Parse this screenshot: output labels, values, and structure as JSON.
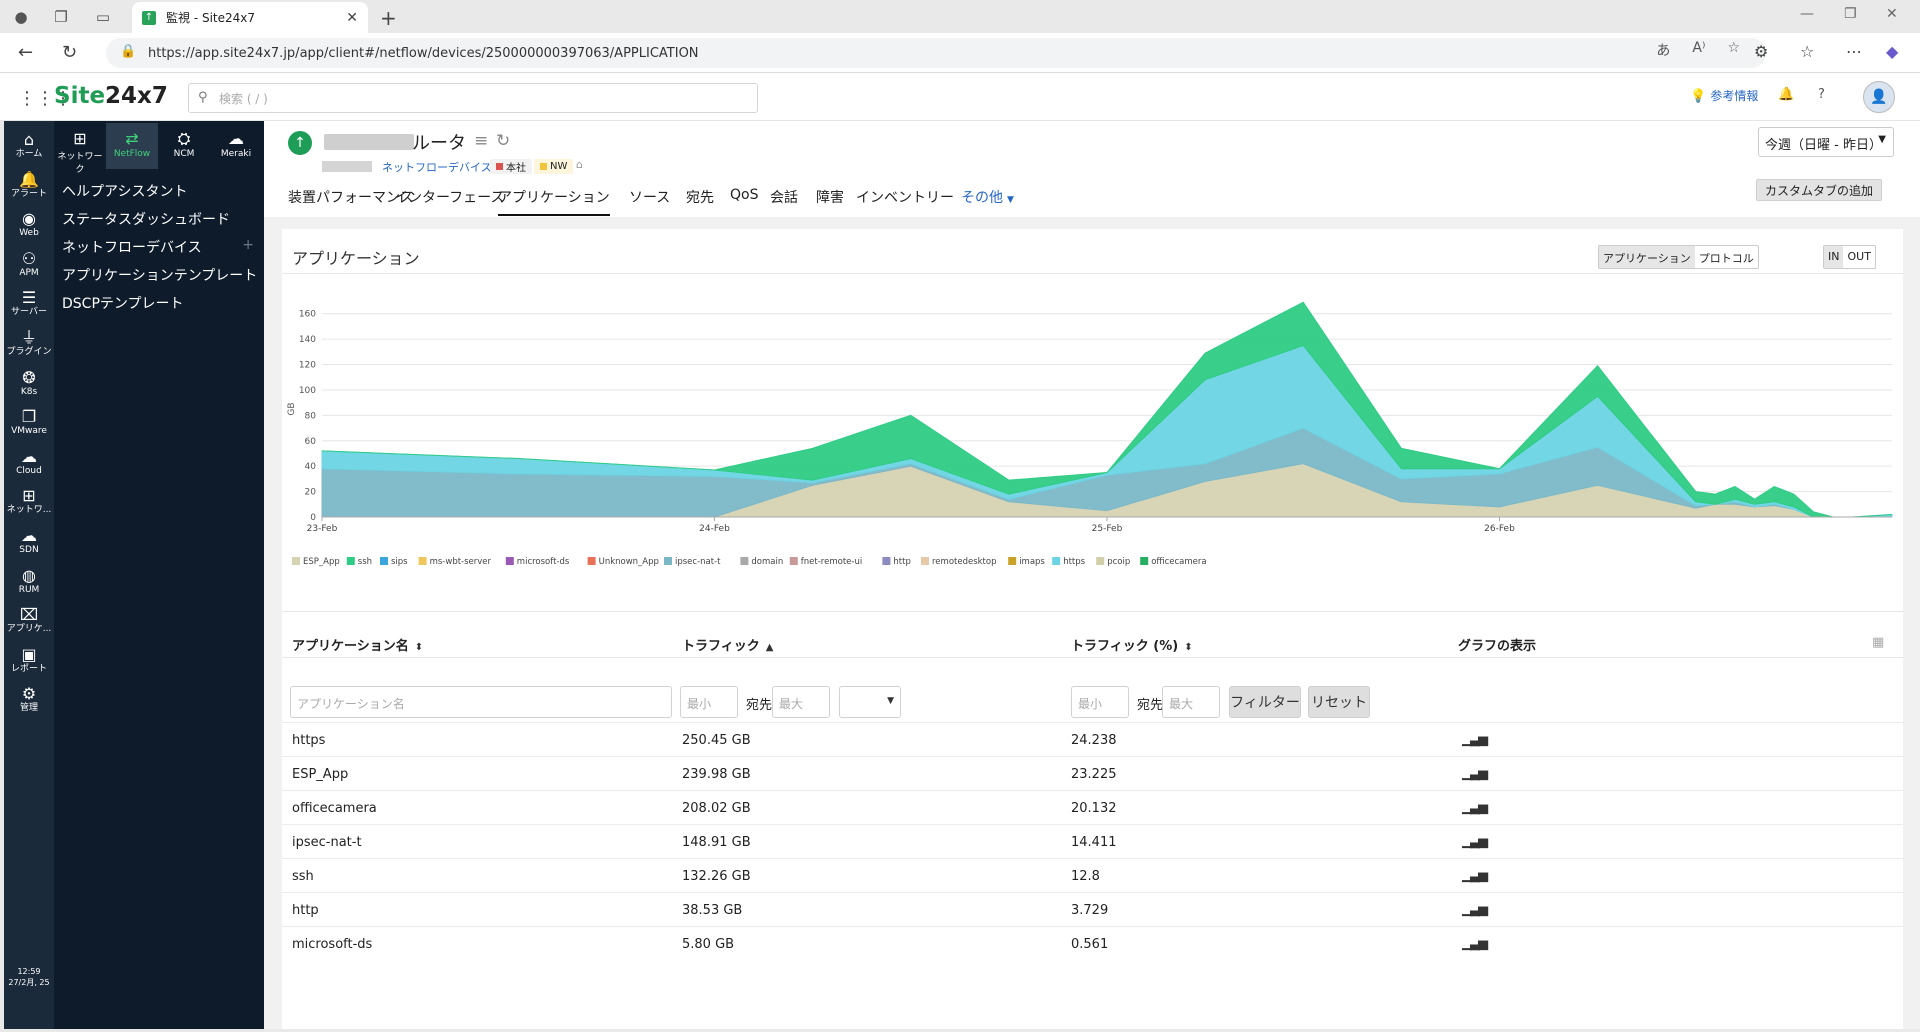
{
  "browser": {
    "tab_title": "監視 - Site24x7",
    "url": "https://app.site24x7.jp/app/client#/netflow/devices/250000000397063/APPLICATION",
    "translate_icon": "translate-icon",
    "read_aloud": "A⁾"
  },
  "app": {
    "logo_a": "Site",
    "logo_b": "24x7",
    "search_placeholder": "検索 ( / )",
    "reference_link": "参考情報",
    "avatar": "👤"
  },
  "rail": {
    "items": [
      {
        "label": "ホーム",
        "icon": "home-icon",
        "glyph": "⌂"
      },
      {
        "label": "アラート",
        "icon": "bell-icon",
        "glyph": "🔔"
      },
      {
        "label": "Web",
        "icon": "globe-icon",
        "glyph": "◉"
      },
      {
        "label": "APM",
        "icon": "binoculars-icon",
        "glyph": "⚇"
      },
      {
        "label": "サーバー",
        "icon": "server-icon",
        "glyph": "☰"
      },
      {
        "label": "プラグイン",
        "icon": "plug-icon",
        "glyph": "⏚"
      },
      {
        "label": "K8s",
        "icon": "k8s-icon",
        "glyph": "❂"
      },
      {
        "label": "VMware",
        "icon": "vmware-icon",
        "glyph": "❐"
      },
      {
        "label": "Cloud",
        "icon": "cloud-icon",
        "glyph": "☁"
      },
      {
        "label": "ネットワ...",
        "icon": "network-icon",
        "glyph": "⊞"
      },
      {
        "label": "SDN",
        "icon": "sdn-icon",
        "glyph": "☁"
      },
      {
        "label": "RUM",
        "icon": "rum-icon",
        "glyph": "◍"
      },
      {
        "label": "アプリケ...",
        "icon": "app-icon",
        "glyph": "⌧"
      },
      {
        "label": "レポート",
        "icon": "report-icon",
        "glyph": "▣"
      },
      {
        "label": "管理",
        "icon": "gear-icon",
        "glyph": "⚙"
      }
    ],
    "time": "12:59",
    "date": "27/2月, 25"
  },
  "sidebar": {
    "subtabs": [
      {
        "label": "ネットワーク",
        "icon": "network-map-icon",
        "glyph": "⊞"
      },
      {
        "label": "NetFlow",
        "icon": "netflow-icon",
        "glyph": "⇄"
      },
      {
        "label": "NCM",
        "icon": "ncm-icon",
        "glyph": "⛭"
      },
      {
        "label": "Meraki",
        "icon": "meraki-icon",
        "glyph": "☁"
      }
    ],
    "links": [
      "ヘルプアシスタント",
      "ステータスダッシュボード",
      "ネットフローデバイス",
      "アプリケーションテンプレート",
      "DSCPテンプレート"
    ],
    "plus": "+"
  },
  "device": {
    "name": "ルータ",
    "type": "ネットフローデバイス",
    "tags": [
      {
        "label": "本社",
        "color": "#d9534f"
      },
      {
        "label": "NW",
        "color": "#f0c43c"
      }
    ],
    "period": "今週（日曜 - 昨日）",
    "custom_tab": "カスタムタブの追加",
    "tabs": [
      "装置パフォーマンス",
      "インターフェース",
      "アプリケーション",
      "ソース",
      "宛先",
      "QoS",
      "会話",
      "障害",
      "インベントリー",
      "その他"
    ]
  },
  "panel": {
    "title": "アプリケーション",
    "toggle_a": "アプリケーション",
    "toggle_b": "プロトコル",
    "dir_in": "IN",
    "dir_out": "OUT"
  },
  "chart_data": {
    "type": "area",
    "ylabel": "GB",
    "ylim": [
      0,
      170
    ],
    "yticks": [
      0,
      20,
      40,
      60,
      80,
      100,
      120,
      140,
      160
    ],
    "xtick_labels": [
      "23-Feb",
      "24-Feb",
      "25-Feb",
      "26-Feb"
    ],
    "x": [
      0,
      0.5,
      1,
      1.25,
      1.5,
      1.75,
      2,
      2.25,
      2.5,
      2.75,
      3,
      3.25,
      3.5,
      3.55,
      3.6,
      3.65,
      3.7,
      3.75,
      3.8,
      3.85,
      3.9,
      4.0
    ],
    "series": [
      {
        "name": "ESP_App",
        "color": "#d6d3b3",
        "values": [
          0,
          0,
          0,
          25,
          40,
          12,
          5,
          28,
          42,
          12,
          8,
          25,
          7,
          10,
          10,
          8,
          9,
          6,
          0,
          0,
          0,
          0
        ]
      },
      {
        "name": "ipsec-nat-t",
        "color": "#7bb8c7",
        "values": [
          38,
          34,
          32,
          2,
          2,
          2,
          28,
          14,
          28,
          18,
          26,
          30,
          2,
          0,
          2,
          0,
          1,
          0,
          0,
          0,
          0,
          0
        ]
      },
      {
        "name": "https",
        "color": "#6cd4e3",
        "values": [
          14,
          12,
          5,
          2,
          4,
          4,
          2,
          66,
          65,
          8,
          4,
          40,
          3,
          0,
          2,
          2,
          2,
          2,
          0,
          0,
          0,
          2
        ]
      },
      {
        "name": "officecamera",
        "color": "#2ecc85",
        "values": [
          0,
          0,
          0,
          25,
          34,
          11,
          0,
          21,
          34,
          16,
          0,
          24,
          8,
          8,
          10,
          4,
          12,
          10,
          4,
          0,
          0,
          0
        ]
      }
    ],
    "legend": [
      "ESP_App",
      "ssh",
      "sips",
      "ms-wbt-server",
      "microsoft-ds",
      "Unknown_App",
      "ipsec-nat-t",
      "domain",
      "fnet-remote-ui",
      "http",
      "remotedesktop",
      "imaps",
      "https",
      "pcoip",
      "officecamera"
    ],
    "legend_colors": [
      "#d6d3b3",
      "#2ecc85",
      "#3aa6dd",
      "#f0c75e",
      "#9b59b6",
      "#e8715a",
      "#7bb8c7",
      "#a9a9a9",
      "#c79a9a",
      "#8b8bbf",
      "#e7c9a8",
      "#c9a227",
      "#6cd4e3",
      "#d2d0a8",
      "#27ae60"
    ]
  },
  "table": {
    "col_name": "アプリケーション名",
    "col_traffic": "トラフィック",
    "col_pct": "トラフィック (%)",
    "col_graph": "グラフの表示",
    "filter": {
      "name_placeholder": "アプリケーション名",
      "min_placeholder": "最小",
      "max_placeholder": "最大",
      "to_label": "宛先",
      "apply": "フィルター",
      "reset": "リセット"
    },
    "rows": [
      {
        "name": "https",
        "traffic": "250.45 GB",
        "pct": "24.238"
      },
      {
        "name": "ESP_App",
        "traffic": "239.98 GB",
        "pct": "23.225"
      },
      {
        "name": "officecamera",
        "traffic": "208.02 GB",
        "pct": "20.132"
      },
      {
        "name": "ipsec-nat-t",
        "traffic": "148.91 GB",
        "pct": "14.411"
      },
      {
        "name": "ssh",
        "traffic": "132.26 GB",
        "pct": "12.8"
      },
      {
        "name": "http",
        "traffic": "38.53 GB",
        "pct": "3.729"
      },
      {
        "name": "microsoft-ds",
        "traffic": "5.80 GB",
        "pct": "0.561"
      }
    ]
  }
}
